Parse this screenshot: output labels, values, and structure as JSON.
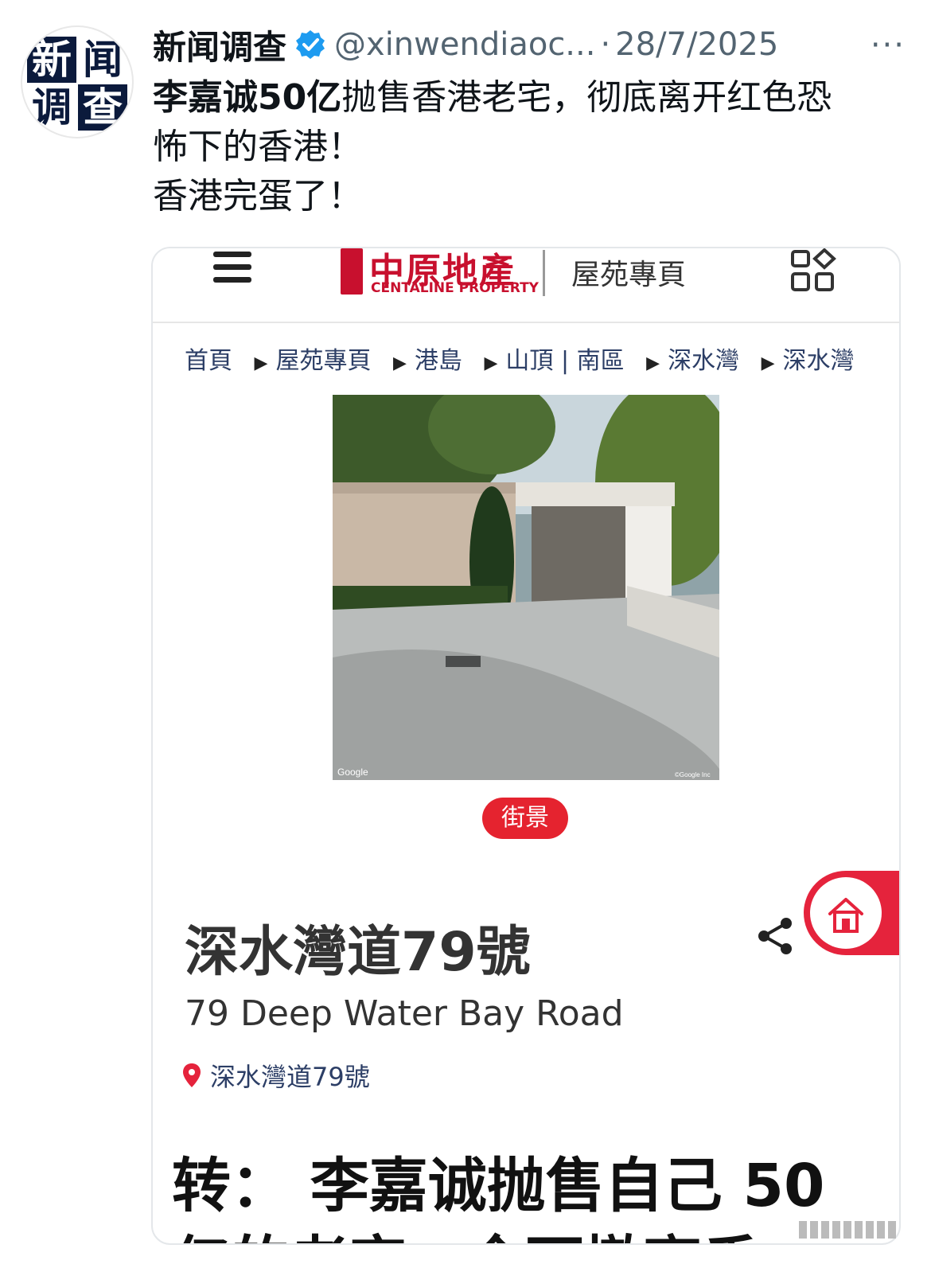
{
  "post": {
    "display_name": "新闻调查",
    "avatar_chars": [
      "新",
      "闻",
      "调",
      "查"
    ],
    "handle": "@xinwendiaoc...",
    "separator": "·",
    "date": "28/7/2025",
    "more": "···",
    "text_bold": "李嘉诚50亿",
    "text_line1": "抛售香港老宅，彻底离开红色恐",
    "text_line2": "怖下的香港！",
    "text_line3": "香港完蛋了！"
  },
  "card": {
    "logo_cn": "中原地產",
    "logo_en": "CENTALINE PROPERTY",
    "section": "屋苑專頁",
    "breadcrumb": [
      "首頁",
      "屋苑專頁",
      "港島",
      "山頂 | 南區",
      "深水灣",
      "深水灣"
    ],
    "photo_credit_left": "Google",
    "photo_credit_right": "©Google Inc",
    "street_view_badge": "街景",
    "title_cn": "深水灣道79號",
    "title_en": "79 Deep Water Bay Road",
    "address": "深水灣道79號",
    "repost_line": "转：  李嘉诚抛售自己 50",
    "repost_line2": "亿的老宅，全面撤离香"
  },
  "colors": {
    "brand_red": "#c8102e",
    "badge_red": "#e5232f",
    "verified_blue": "#1d9bf0",
    "muted_text": "#536471"
  },
  "icons": [
    "verified-icon",
    "more-icon",
    "hamburger-icon",
    "apps-icon",
    "share-icon",
    "home-icon",
    "location-pin-icon"
  ]
}
